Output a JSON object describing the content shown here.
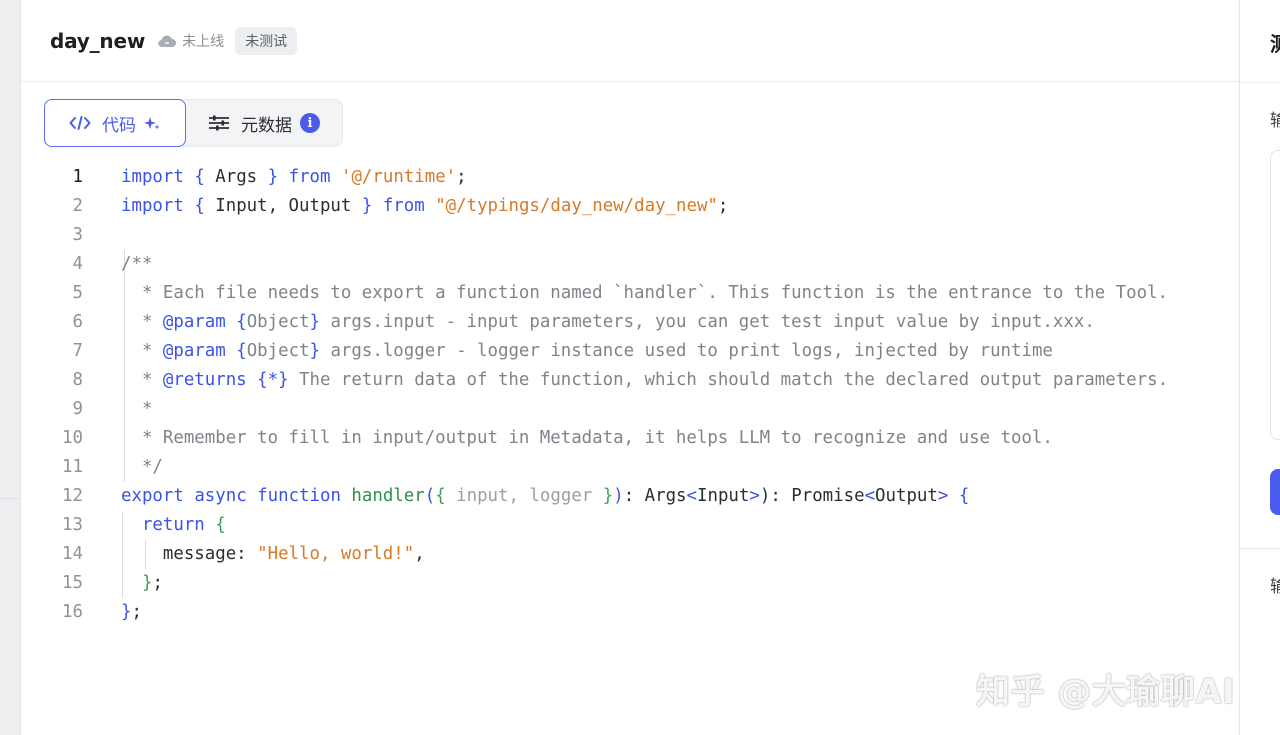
{
  "header": {
    "title": "day_new",
    "status_label": "未上线",
    "badge": "未测试"
  },
  "tabs": [
    {
      "label": "代码",
      "active": true,
      "icon": "code-icon",
      "extra_icon": "sparkle-icon"
    },
    {
      "label": "元数据",
      "active": false,
      "icon": "sliders-icon",
      "extra_icon": "info-icon",
      "info_glyph": "i"
    }
  ],
  "editor": {
    "current_line": 1,
    "line_numbers": [
      "1",
      "2",
      "3",
      "4",
      "5",
      "6",
      "7",
      "8",
      "9",
      "10",
      "11",
      "12",
      "13",
      "14",
      "15",
      "16"
    ],
    "lines": [
      [
        [
          "k",
          "import"
        ],
        [
          "t",
          " "
        ],
        [
          "br",
          "{"
        ],
        [
          "t",
          " Args "
        ],
        [
          "br",
          "}"
        ],
        [
          "t",
          " "
        ],
        [
          "k",
          "from"
        ],
        [
          "t",
          " "
        ],
        [
          "s",
          "'@/runtime'"
        ],
        [
          "t",
          ";"
        ]
      ],
      [
        [
          "k",
          "import"
        ],
        [
          "t",
          " "
        ],
        [
          "br",
          "{"
        ],
        [
          "t",
          " Input, Output "
        ],
        [
          "br",
          "}"
        ],
        [
          "t",
          " "
        ],
        [
          "k",
          "from"
        ],
        [
          "t",
          " "
        ],
        [
          "s",
          "\"@/typings/day_new/day_new\""
        ],
        [
          "t",
          ";"
        ]
      ],
      [],
      [
        [
          "c",
          "/**"
        ]
      ],
      [
        [
          "c",
          "  * Each file needs to export a function named `handler`. This function is the entrance to the Tool."
        ]
      ],
      [
        [
          "c",
          "  * "
        ],
        [
          "p",
          "@param"
        ],
        [
          "c",
          " "
        ],
        [
          "p",
          "{"
        ],
        [
          "c",
          "Object"
        ],
        [
          "p",
          "}"
        ],
        [
          "c",
          " args.input - input parameters, you can get test input value by input.xxx."
        ]
      ],
      [
        [
          "c",
          "  * "
        ],
        [
          "p",
          "@param"
        ],
        [
          "c",
          " "
        ],
        [
          "p",
          "{"
        ],
        [
          "c",
          "Object"
        ],
        [
          "p",
          "}"
        ],
        [
          "c",
          " args.logger - logger instance used to print logs, injected by runtime"
        ]
      ],
      [
        [
          "c",
          "  * "
        ],
        [
          "p",
          "@returns"
        ],
        [
          "c",
          " "
        ],
        [
          "p",
          "{*}"
        ],
        [
          "c",
          " The return data of the function, which should match the declared output parameters."
        ]
      ],
      [
        [
          "c",
          "  *"
        ]
      ],
      [
        [
          "c",
          "  * Remember to fill in input/output in Metadata, it helps LLM to recognize and use tool."
        ]
      ],
      [
        [
          "c",
          "  */"
        ]
      ],
      [
        [
          "k",
          "export"
        ],
        [
          "t",
          " "
        ],
        [
          "k",
          "async"
        ],
        [
          "t",
          " "
        ],
        [
          "k",
          "function"
        ],
        [
          "t",
          " "
        ],
        [
          "f",
          "handler"
        ],
        [
          "br",
          "("
        ],
        [
          "brg",
          "{"
        ],
        [
          "g",
          " input, logger "
        ],
        [
          "brg",
          "}"
        ],
        [
          "br",
          ")"
        ],
        [
          "t",
          ": Args"
        ],
        [
          "br",
          "<"
        ],
        [
          "t",
          "Input"
        ],
        [
          "br",
          ">"
        ],
        [
          "t",
          "): Promise"
        ],
        [
          "br",
          "<"
        ],
        [
          "t",
          "Output"
        ],
        [
          "br",
          ">"
        ],
        [
          "t",
          " "
        ],
        [
          "br",
          "{"
        ]
      ],
      [
        [
          "t",
          "  "
        ],
        [
          "k",
          "return"
        ],
        [
          "t",
          " "
        ],
        [
          "brg",
          "{"
        ]
      ],
      [
        [
          "t",
          "    message: "
        ],
        [
          "s",
          "\"Hello, world!\""
        ],
        [
          "t",
          ","
        ]
      ],
      [
        [
          "t",
          "  "
        ],
        [
          "brg",
          "}"
        ],
        [
          "t",
          ";"
        ]
      ],
      [
        [
          "br",
          "}"
        ],
        [
          "t",
          ";"
        ]
      ]
    ]
  },
  "right_panel": {
    "title_glyph": "测",
    "label_1": "输",
    "label_2": "输"
  },
  "watermark": "知乎 @大瑜聊AI"
}
